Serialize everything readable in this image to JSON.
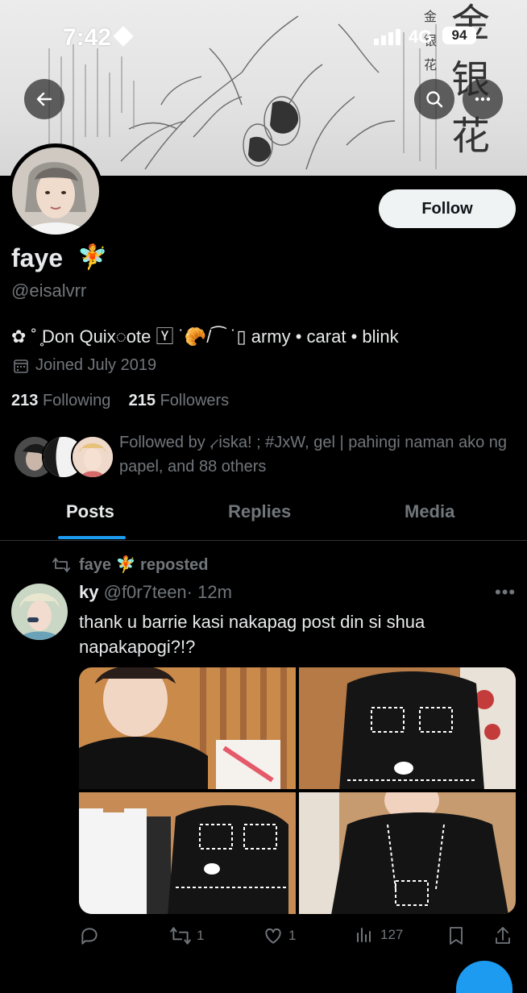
{
  "status": {
    "time": "7:42",
    "network": "4G",
    "battery": "94"
  },
  "banner": {
    "title_chars": [
      "金",
      "银",
      "花"
    ],
    "side_text": [
      "金",
      "银",
      "花"
    ]
  },
  "profile": {
    "name": "faye",
    "name_emoji": "🧚",
    "handle": "@eisalvrr",
    "bio": "✿ ˚ ̥Don Quix◌ote 🅈 ˙🥐/⁀ ˙▯ army • carat • blink",
    "joined": "Joined July 2019",
    "following_count": "213",
    "following_label": "Following",
    "followers_count": "215",
    "followers_label": "Followers",
    "followed_by": "Followed by ,̷ iska! ; #JxW, gel | pahingi naman ako ng papel, and 88 others",
    "follow_label": "Follow"
  },
  "tabs": [
    {
      "label": "Posts"
    },
    {
      "label": "Replies"
    },
    {
      "label": "Media"
    }
  ],
  "post": {
    "repost_by": "faye 🧚 reposted",
    "author": "ky",
    "author_handle": "@f0r7teen",
    "time": "· 12m",
    "text": "thank u barrie kasi nakapag post din si shua napakapogi?!?",
    "reposts": "1",
    "likes": "1",
    "views": "127"
  },
  "icons": [
    "back-icon",
    "search-icon",
    "more-icon",
    "calendar-icon",
    "repost-icon",
    "reply-icon",
    "like-icon",
    "views-icon",
    "bookmark-icon",
    "share-icon"
  ],
  "colors": {
    "accent": "#1d9bf0",
    "muted": "#71767b",
    "text": "#e7e9ea",
    "bg": "#000000"
  }
}
